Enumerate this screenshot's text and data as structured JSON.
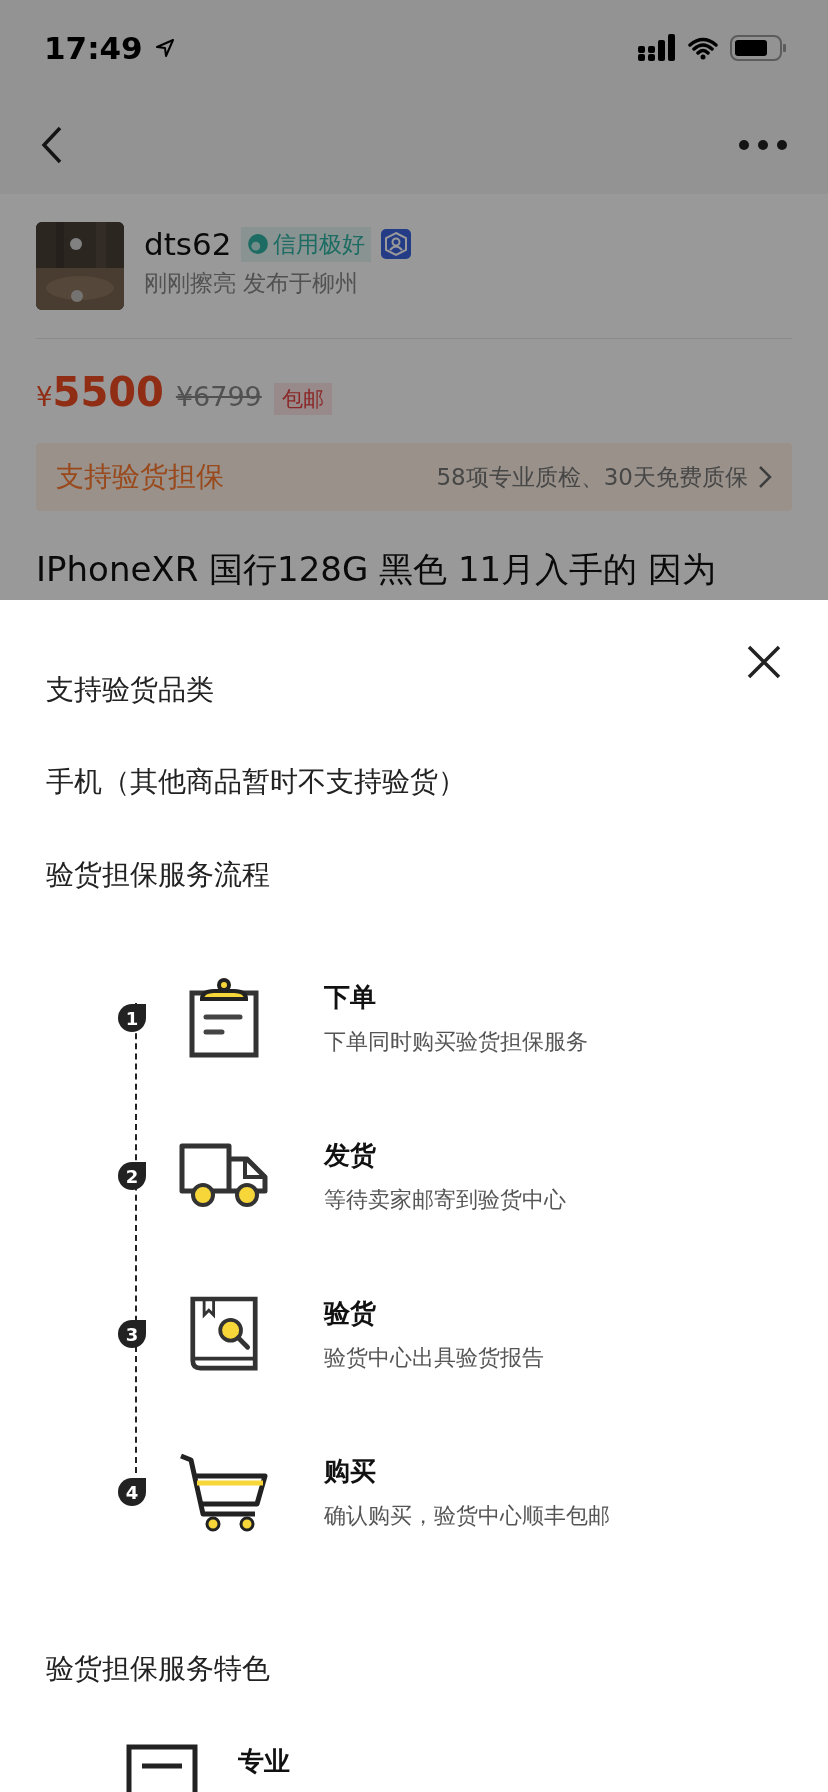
{
  "status_bar": {
    "time": "17:49"
  },
  "seller": {
    "name": "dts62",
    "credit_badge": "信用极好",
    "subtitle": "刚刚擦亮 发布于柳州"
  },
  "price": {
    "currency": "¥",
    "current": "5500",
    "original": "¥6799",
    "shipping_tag": "包邮"
  },
  "guarantee_banner": {
    "title": "支持验货担保",
    "detail": "58项专业质检、30天免费质保"
  },
  "item_title": "IPhoneXR 国行128G 黑色 11月入手的 因为",
  "sheet": {
    "category_heading": "支持验货品类",
    "category_text": "手机（其他商品暂时不支持验货）",
    "process_heading": "验货担保服务流程",
    "steps": [
      {
        "number": "1",
        "kind": "order",
        "title": "下单",
        "description": "下单同时购买验货担保服务"
      },
      {
        "number": "2",
        "kind": "ship",
        "title": "发货",
        "description": "等待卖家邮寄到验货中心"
      },
      {
        "number": "3",
        "kind": "inspect",
        "title": "验货",
        "description": "验货中心出具验货报告"
      },
      {
        "number": "4",
        "kind": "buy",
        "title": "购买",
        "description": "确认购买，验货中心顺丰包邮"
      }
    ],
    "features_heading": "验货担保服务特色",
    "features": [
      {
        "kind": "report",
        "title": "专业"
      }
    ]
  }
}
